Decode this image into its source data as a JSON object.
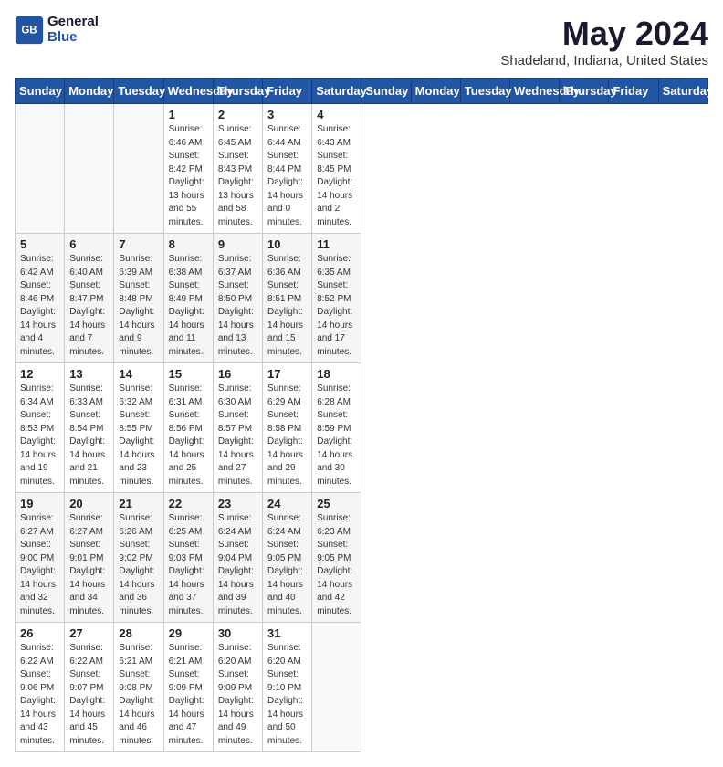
{
  "header": {
    "logo_line1": "General",
    "logo_line2": "Blue",
    "month_year": "May 2024",
    "location": "Shadeland, Indiana, United States"
  },
  "days_of_week": [
    "Sunday",
    "Monday",
    "Tuesday",
    "Wednesday",
    "Thursday",
    "Friday",
    "Saturday"
  ],
  "weeks": [
    [
      {
        "day": "",
        "info": ""
      },
      {
        "day": "",
        "info": ""
      },
      {
        "day": "",
        "info": ""
      },
      {
        "day": "1",
        "info": "Sunrise: 6:46 AM\nSunset: 8:42 PM\nDaylight: 13 hours\nand 55 minutes."
      },
      {
        "day": "2",
        "info": "Sunrise: 6:45 AM\nSunset: 8:43 PM\nDaylight: 13 hours\nand 58 minutes."
      },
      {
        "day": "3",
        "info": "Sunrise: 6:44 AM\nSunset: 8:44 PM\nDaylight: 14 hours\nand 0 minutes."
      },
      {
        "day": "4",
        "info": "Sunrise: 6:43 AM\nSunset: 8:45 PM\nDaylight: 14 hours\nand 2 minutes."
      }
    ],
    [
      {
        "day": "5",
        "info": "Sunrise: 6:42 AM\nSunset: 8:46 PM\nDaylight: 14 hours\nand 4 minutes."
      },
      {
        "day": "6",
        "info": "Sunrise: 6:40 AM\nSunset: 8:47 PM\nDaylight: 14 hours\nand 7 minutes."
      },
      {
        "day": "7",
        "info": "Sunrise: 6:39 AM\nSunset: 8:48 PM\nDaylight: 14 hours\nand 9 minutes."
      },
      {
        "day": "8",
        "info": "Sunrise: 6:38 AM\nSunset: 8:49 PM\nDaylight: 14 hours\nand 11 minutes."
      },
      {
        "day": "9",
        "info": "Sunrise: 6:37 AM\nSunset: 8:50 PM\nDaylight: 14 hours\nand 13 minutes."
      },
      {
        "day": "10",
        "info": "Sunrise: 6:36 AM\nSunset: 8:51 PM\nDaylight: 14 hours\nand 15 minutes."
      },
      {
        "day": "11",
        "info": "Sunrise: 6:35 AM\nSunset: 8:52 PM\nDaylight: 14 hours\nand 17 minutes."
      }
    ],
    [
      {
        "day": "12",
        "info": "Sunrise: 6:34 AM\nSunset: 8:53 PM\nDaylight: 14 hours\nand 19 minutes."
      },
      {
        "day": "13",
        "info": "Sunrise: 6:33 AM\nSunset: 8:54 PM\nDaylight: 14 hours\nand 21 minutes."
      },
      {
        "day": "14",
        "info": "Sunrise: 6:32 AM\nSunset: 8:55 PM\nDaylight: 14 hours\nand 23 minutes."
      },
      {
        "day": "15",
        "info": "Sunrise: 6:31 AM\nSunset: 8:56 PM\nDaylight: 14 hours\nand 25 minutes."
      },
      {
        "day": "16",
        "info": "Sunrise: 6:30 AM\nSunset: 8:57 PM\nDaylight: 14 hours\nand 27 minutes."
      },
      {
        "day": "17",
        "info": "Sunrise: 6:29 AM\nSunset: 8:58 PM\nDaylight: 14 hours\nand 29 minutes."
      },
      {
        "day": "18",
        "info": "Sunrise: 6:28 AM\nSunset: 8:59 PM\nDaylight: 14 hours\nand 30 minutes."
      }
    ],
    [
      {
        "day": "19",
        "info": "Sunrise: 6:27 AM\nSunset: 9:00 PM\nDaylight: 14 hours\nand 32 minutes."
      },
      {
        "day": "20",
        "info": "Sunrise: 6:27 AM\nSunset: 9:01 PM\nDaylight: 14 hours\nand 34 minutes."
      },
      {
        "day": "21",
        "info": "Sunrise: 6:26 AM\nSunset: 9:02 PM\nDaylight: 14 hours\nand 36 minutes."
      },
      {
        "day": "22",
        "info": "Sunrise: 6:25 AM\nSunset: 9:03 PM\nDaylight: 14 hours\nand 37 minutes."
      },
      {
        "day": "23",
        "info": "Sunrise: 6:24 AM\nSunset: 9:04 PM\nDaylight: 14 hours\nand 39 minutes."
      },
      {
        "day": "24",
        "info": "Sunrise: 6:24 AM\nSunset: 9:05 PM\nDaylight: 14 hours\nand 40 minutes."
      },
      {
        "day": "25",
        "info": "Sunrise: 6:23 AM\nSunset: 9:05 PM\nDaylight: 14 hours\nand 42 minutes."
      }
    ],
    [
      {
        "day": "26",
        "info": "Sunrise: 6:22 AM\nSunset: 9:06 PM\nDaylight: 14 hours\nand 43 minutes."
      },
      {
        "day": "27",
        "info": "Sunrise: 6:22 AM\nSunset: 9:07 PM\nDaylight: 14 hours\nand 45 minutes."
      },
      {
        "day": "28",
        "info": "Sunrise: 6:21 AM\nSunset: 9:08 PM\nDaylight: 14 hours\nand 46 minutes."
      },
      {
        "day": "29",
        "info": "Sunrise: 6:21 AM\nSunset: 9:09 PM\nDaylight: 14 hours\nand 47 minutes."
      },
      {
        "day": "30",
        "info": "Sunrise: 6:20 AM\nSunset: 9:09 PM\nDaylight: 14 hours\nand 49 minutes."
      },
      {
        "day": "31",
        "info": "Sunrise: 6:20 AM\nSunset: 9:10 PM\nDaylight: 14 hours\nand 50 minutes."
      },
      {
        "day": "",
        "info": ""
      }
    ]
  ]
}
